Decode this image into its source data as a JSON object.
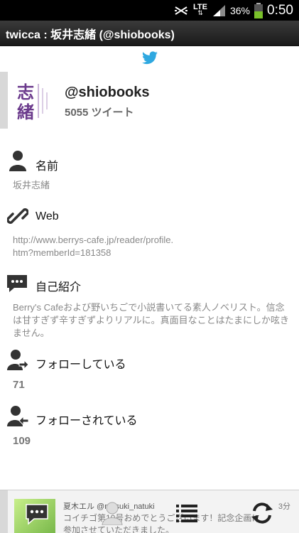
{
  "status_bar": {
    "network": "LTE",
    "battery_percent": "36%",
    "time": "0:50",
    "icons": [
      "mute-icon",
      "lte-icon",
      "signal-icon",
      "battery-icon"
    ]
  },
  "titlebar": {
    "title": "twicca : 坂井志緒 (@shiobooks)"
  },
  "profile": {
    "screen_name": "@shiobooks",
    "tweet_count": "5055 ツイート"
  },
  "sections": {
    "name": {
      "label": "名前",
      "value": "坂井志緒",
      "icon": "person-icon"
    },
    "web": {
      "label": "Web",
      "value_line1": "http://www.berrys-cafe.jp/reader/profile.",
      "value_line2": "htm?memberId=181358",
      "icon": "link-icon"
    },
    "bio": {
      "label": "自己紹介",
      "value_line1": "Berry's Cafeおよび野いちごで小説書いてる素人ノベリスト。信念",
      "value_line2": "は甘すぎず辛すぎずよりリアルに。真面目なことはたまにしか呟き",
      "value_line3": "ません。",
      "icon": "speech-bubble-icon"
    },
    "following": {
      "label": "フォローしている",
      "count": "71",
      "icon": "following-icon"
    },
    "followers": {
      "label": "フォローされている",
      "count": "109",
      "icon": "followers-icon"
    }
  },
  "bottom_bar": {
    "tweet_name": "夏木エル @natsuki_natuki",
    "tweet_text_line1": "コイチゴ第10号おめでとうございます！記念企画に",
    "tweet_text_line2": "参加させていただきました。",
    "tweet_time": "3分",
    "buttons": [
      "reply-icon",
      "profile-icon",
      "menu-icon",
      "refresh-icon"
    ]
  }
}
